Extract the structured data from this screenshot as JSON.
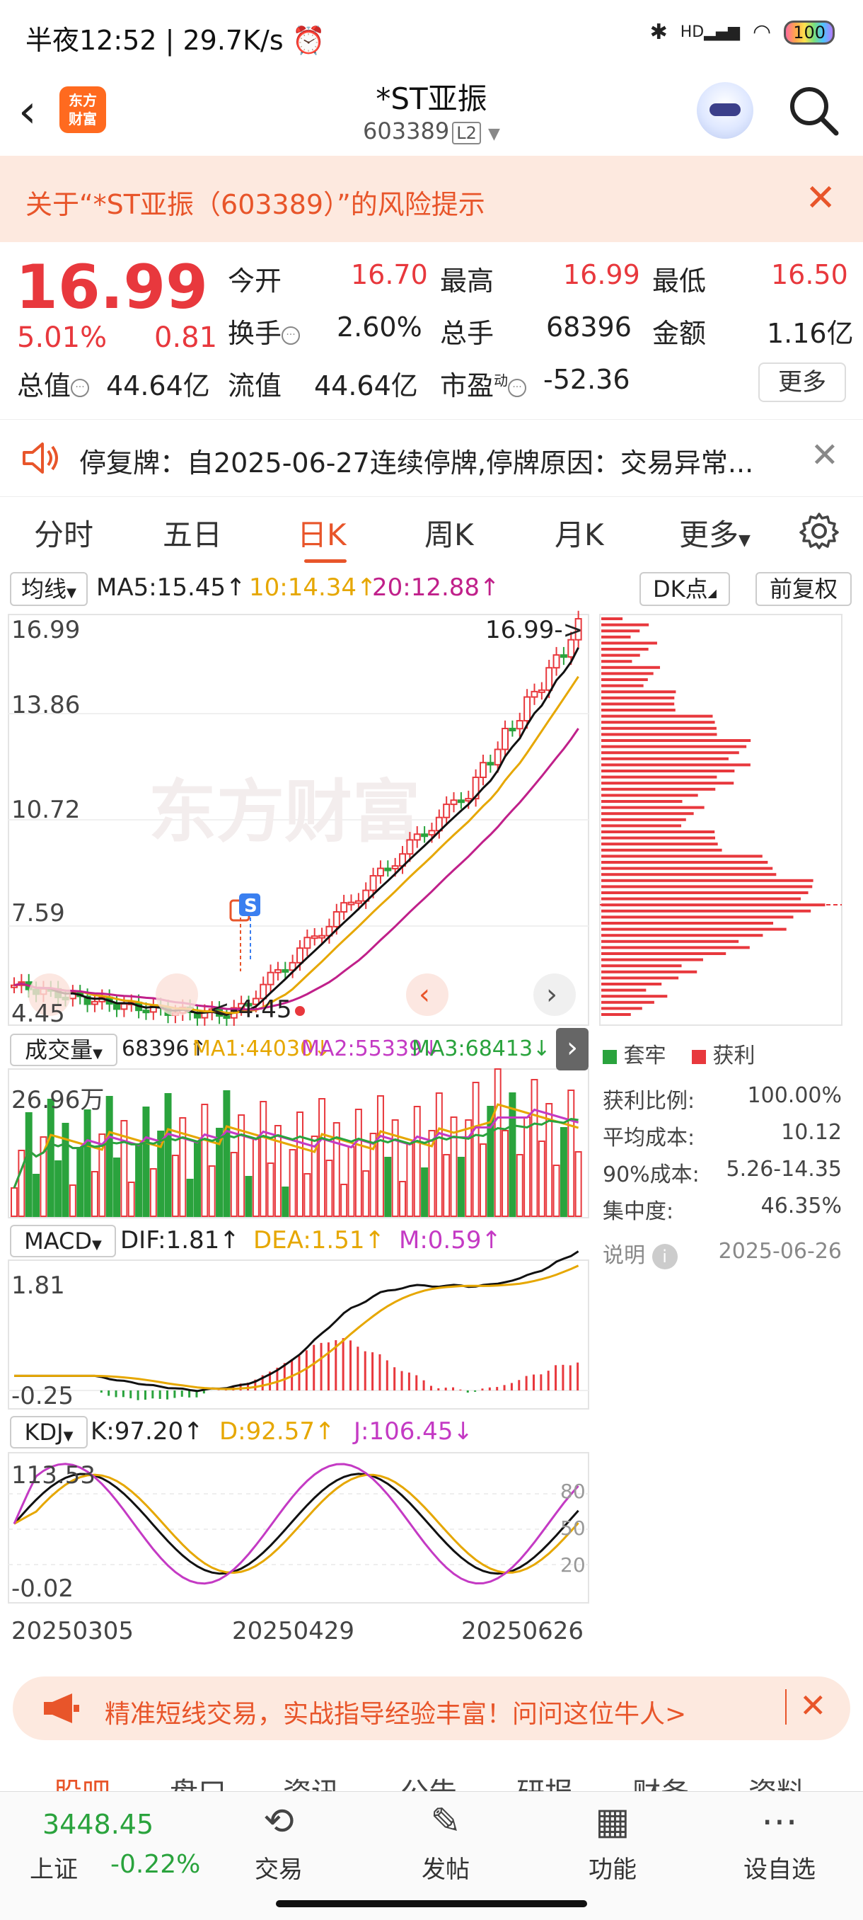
{
  "status_bar": {
    "time": "半夜12:52",
    "speed": "29.7K/s",
    "network": "HD",
    "battery": "100"
  },
  "header": {
    "logo": "东方财富",
    "title": "*ST亚振",
    "code": "603389",
    "level": "L2"
  },
  "risk_banner": {
    "text": "关于“*ST亚振（603389）”的风险提示"
  },
  "quote": {
    "price": "16.99",
    "pct": "5.01%",
    "change": "0.81",
    "open_label": "今开",
    "open": "16.70",
    "high_label": "最高",
    "high": "16.99",
    "low_label": "最低",
    "low": "16.50",
    "turnover_label": "换手",
    "turnover": "2.60%",
    "volume_label": "总手",
    "volume": "68396",
    "amount_label": "金额",
    "amount": "1.16亿",
    "mcap_label": "总值",
    "mcap": "44.64亿",
    "float_label": "流值",
    "float": "44.64亿",
    "pe_label": "市盈",
    "pe_sup": "动",
    "pe": "-52.36",
    "more": "更多"
  },
  "notice": {
    "text": "停复牌：自2025-06-27连续停牌,停牌原因：交易异常..."
  },
  "tabs": [
    "分时",
    "五日",
    "日K",
    "周K",
    "月K",
    "更多"
  ],
  "active_tab": "日K",
  "kline": {
    "ma_btn": "均线",
    "ma5": "MA5:15.45↑",
    "ma10": "10:14.34↑",
    "ma20": "20:12.88↑",
    "dk_btn": "DK点",
    "adj_btn": "前复权",
    "y_labels": [
      "16.99",
      "13.86",
      "10.72",
      "7.59",
      "4.45"
    ],
    "last_price_label": "16.99->",
    "low_label": "<-4.45",
    "watermark": "东方财富",
    "badge": "S"
  },
  "volume": {
    "btn": "成交量",
    "value": "68396↑",
    "ma1": "MA1:44030↓",
    "ma2": "MA2:55339↓",
    "ma3": "MA3:68413↓",
    "y_label": "26.96万"
  },
  "macd": {
    "btn": "MACD",
    "dif": "DIF:1.81↑",
    "dea": "DEA:1.51↑",
    "m": "M:0.59↑",
    "y_top": "1.81",
    "y_bottom": "-0.25"
  },
  "kdj": {
    "btn": "KDJ",
    "k": "K:97.20↑",
    "d": "D:92.57↑",
    "j": "J:106.45↓",
    "y_top": "113.53",
    "y_bottom": "-0.02",
    "levels": [
      "80",
      "50",
      "20"
    ]
  },
  "dates": [
    "20250305",
    "20250429",
    "20250626"
  ],
  "chip": {
    "legend_trapped": "套牢",
    "legend_profit": "获利",
    "rows": [
      {
        "label": "获利比例:",
        "value": "100.00%"
      },
      {
        "label": "平均成本:",
        "value": "10.12"
      },
      {
        "label": "90%成本:",
        "value": "5.26-14.35"
      },
      {
        "label": "集中度:",
        "value": "46.35%"
      }
    ],
    "note_label": "说明",
    "date": "2025-06-26"
  },
  "ad": {
    "text": "精准短线交易，实战指导经验丰富！问问这位牛人>"
  },
  "subtabs": [
    "股吧",
    "盘口",
    "资讯",
    "公告",
    "研报",
    "财务",
    "资料"
  ],
  "bottom_nav": {
    "index_value": "3448.45",
    "index_name": "上证",
    "index_change": "-0.22%",
    "items": [
      "交易",
      "发帖",
      "功能",
      "设自选"
    ]
  },
  "colors": {
    "up": "#e8383d",
    "down": "#2aa33d",
    "accent": "#e8552a",
    "ma10": "#e6a700",
    "ma20": "#c0208a"
  }
}
